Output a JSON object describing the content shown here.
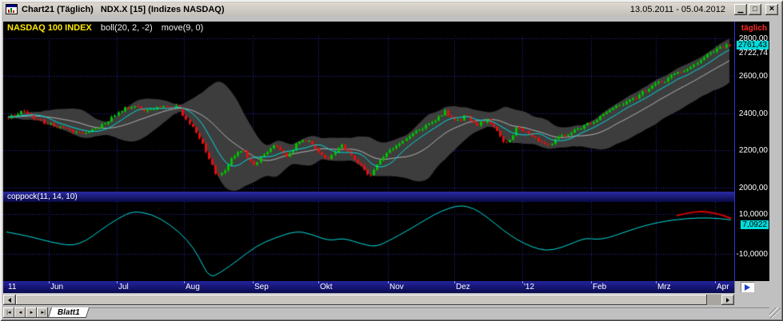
{
  "window": {
    "title_left": "Chart21 (Täglich)",
    "title_right": "NDX.X [15] (Indizes NASDAQ)",
    "date_range": "13.05.2011 - 05.04.2012"
  },
  "icons": {
    "minimize_glyph": "▁",
    "restore_glyph": "□",
    "close_glyph": "×",
    "nav_first": "|◄",
    "nav_prev": "◄",
    "nav_next": "►",
    "nav_last": "►|"
  },
  "main_chart": {
    "header": {
      "symbol": "NASDAQ 100 INDEX",
      "indicator1": "boll(20, 2, -2)",
      "indicator2": "move(9, 0)",
      "period": "täglich"
    },
    "axis": {
      "levels": [
        {
          "label": "2800,00",
          "value": 2800
        },
        {
          "label": "2600,00",
          "value": 2600
        },
        {
          "label": "2400,00",
          "value": 2400
        },
        {
          "label": "2200,00",
          "value": 2200
        },
        {
          "label": "2000,00",
          "value": 2000
        }
      ],
      "last_price_label": "2761,43",
      "ma_label": "2722,74",
      "ma_value": 2722.74
    }
  },
  "coppock": {
    "label": "coppock(11, 14, 10)",
    "axis_high": "10,0000",
    "axis_low": "-10,0000",
    "last_value_label": "7,0922"
  },
  "x_axis": {
    "months": [
      {
        "label": "11",
        "frac": 0.0
      },
      {
        "label": "Jun",
        "frac": 0.058
      },
      {
        "label": "Jul",
        "frac": 0.152
      },
      {
        "label": "Aug",
        "frac": 0.245
      },
      {
        "label": "Sep",
        "frac": 0.34
      },
      {
        "label": "Okt",
        "frac": 0.431
      },
      {
        "label": "Nov",
        "frac": 0.526
      },
      {
        "label": "Dez",
        "frac": 0.618
      },
      {
        "label": "'12",
        "frac": 0.712
      },
      {
        "label": "Feb",
        "frac": 0.807
      },
      {
        "label": "Mrz",
        "frac": 0.896
      },
      {
        "label": "Apr",
        "frac": 0.978
      }
    ]
  },
  "sheets": {
    "active": "Blatt1"
  },
  "colors": {
    "up": "#00c000",
    "down": "#e01010",
    "band": "#3d3d3d",
    "ma": "#00e0e0",
    "boll_mid": "#b4b4b4",
    "line": "#00e0e0",
    "annotation": "#dd0000",
    "grid": "#2828ac",
    "badge_bg": "#00dbdb"
  },
  "chart_data": [
    {
      "type": "candlestick",
      "title": "NASDAQ 100 INDEX",
      "overlays": [
        "boll(20, 2, -2)",
        "move(9, 0)"
      ],
      "period": "daily",
      "date_range": [
        "13.05.2011",
        "05.04.2012"
      ],
      "ylim": [
        2000,
        2800
      ],
      "grid_levels": [
        2800,
        2600,
        2400,
        2200,
        2000
      ],
      "candle_count": 224,
      "last_close": 2761.43,
      "close_anchors": [
        [
          0.0,
          2380
        ],
        [
          0.02,
          2405
        ],
        [
          0.05,
          2350
        ],
        [
          0.08,
          2310
        ],
        [
          0.105,
          2290
        ],
        [
          0.13,
          2335
        ],
        [
          0.155,
          2410
        ],
        [
          0.175,
          2445
        ],
        [
          0.19,
          2410
        ],
        [
          0.21,
          2435
        ],
        [
          0.235,
          2435
        ],
        [
          0.25,
          2350
        ],
        [
          0.263,
          2280
        ],
        [
          0.278,
          2150
        ],
        [
          0.29,
          2060
        ],
        [
          0.3,
          2095
        ],
        [
          0.312,
          2165
        ],
        [
          0.325,
          2200
        ],
        [
          0.34,
          2120
        ],
        [
          0.355,
          2185
        ],
        [
          0.37,
          2230
        ],
        [
          0.385,
          2160
        ],
        [
          0.4,
          2235
        ],
        [
          0.415,
          2260
        ],
        [
          0.43,
          2200
        ],
        [
          0.445,
          2150
        ],
        [
          0.46,
          2230
        ],
        [
          0.475,
          2170
        ],
        [
          0.49,
          2115
        ],
        [
          0.5,
          2060
        ],
        [
          0.515,
          2145
        ],
        [
          0.53,
          2205
        ],
        [
          0.55,
          2255
        ],
        [
          0.57,
          2315
        ],
        [
          0.59,
          2355
        ],
        [
          0.605,
          2410
        ],
        [
          0.62,
          2350
        ],
        [
          0.635,
          2385
        ],
        [
          0.65,
          2335
        ],
        [
          0.665,
          2370
        ],
        [
          0.68,
          2280
        ],
        [
          0.69,
          2235
        ],
        [
          0.705,
          2320
        ],
        [
          0.72,
          2300
        ],
        [
          0.735,
          2255
        ],
        [
          0.75,
          2230
        ],
        [
          0.765,
          2280
        ],
        [
          0.78,
          2290
        ],
        [
          0.795,
          2325
        ],
        [
          0.81,
          2355
        ],
        [
          0.83,
          2405
        ],
        [
          0.85,
          2445
        ],
        [
          0.87,
          2485
        ],
        [
          0.89,
          2540
        ],
        [
          0.91,
          2575
        ],
        [
          0.93,
          2615
        ],
        [
          0.95,
          2655
        ],
        [
          0.97,
          2715
        ],
        [
          0.985,
          2750
        ],
        [
          1.0,
          2761.43
        ]
      ]
    },
    {
      "type": "line",
      "title": "coppock(11, 14, 10)",
      "grid_values": [
        10,
        -10
      ],
      "last_value": 7.0922,
      "points": [
        [
          0.0,
          1.0
        ],
        [
          0.03,
          -1.0
        ],
        [
          0.06,
          -4.0
        ],
        [
          0.09,
          -6.0
        ],
        [
          0.11,
          -3.5
        ],
        [
          0.13,
          2.0
        ],
        [
          0.155,
          8.0
        ],
        [
          0.175,
          11.5
        ],
        [
          0.2,
          10.0
        ],
        [
          0.225,
          5.0
        ],
        [
          0.25,
          -3.0
        ],
        [
          0.265,
          -11.0
        ],
        [
          0.28,
          -22.0
        ],
        [
          0.295,
          -19.5
        ],
        [
          0.32,
          -13.0
        ],
        [
          0.345,
          -6.0
        ],
        [
          0.37,
          -2.0
        ],
        [
          0.4,
          1.5
        ],
        [
          0.42,
          0.0
        ],
        [
          0.445,
          -3.5
        ],
        [
          0.465,
          -2.0
        ],
        [
          0.49,
          -5.0
        ],
        [
          0.51,
          -6.5
        ],
        [
          0.53,
          -3.0
        ],
        [
          0.555,
          2.0
        ],
        [
          0.58,
          7.5
        ],
        [
          0.6,
          11.5
        ],
        [
          0.625,
          14.5
        ],
        [
          0.645,
          13.0
        ],
        [
          0.665,
          8.0
        ],
        [
          0.685,
          2.0
        ],
        [
          0.705,
          -3.0
        ],
        [
          0.725,
          -6.5
        ],
        [
          0.745,
          -8.5
        ],
        [
          0.765,
          -7.0
        ],
        [
          0.785,
          -4.0
        ],
        [
          0.8,
          -2.0
        ],
        [
          0.815,
          -2.8
        ],
        [
          0.83,
          -2.0
        ],
        [
          0.85,
          0.5
        ],
        [
          0.87,
          3.0
        ],
        [
          0.89,
          5.0
        ],
        [
          0.91,
          6.5
        ],
        [
          0.94,
          7.8
        ],
        [
          0.97,
          8.2
        ],
        [
          1.0,
          7.0922
        ]
      ],
      "annotation": [
        [
          0.925,
          9.2
        ],
        [
          0.945,
          11.0
        ],
        [
          0.965,
          11.3
        ],
        [
          0.985,
          9.8
        ],
        [
          1.0,
          7.8
        ]
      ]
    }
  ]
}
